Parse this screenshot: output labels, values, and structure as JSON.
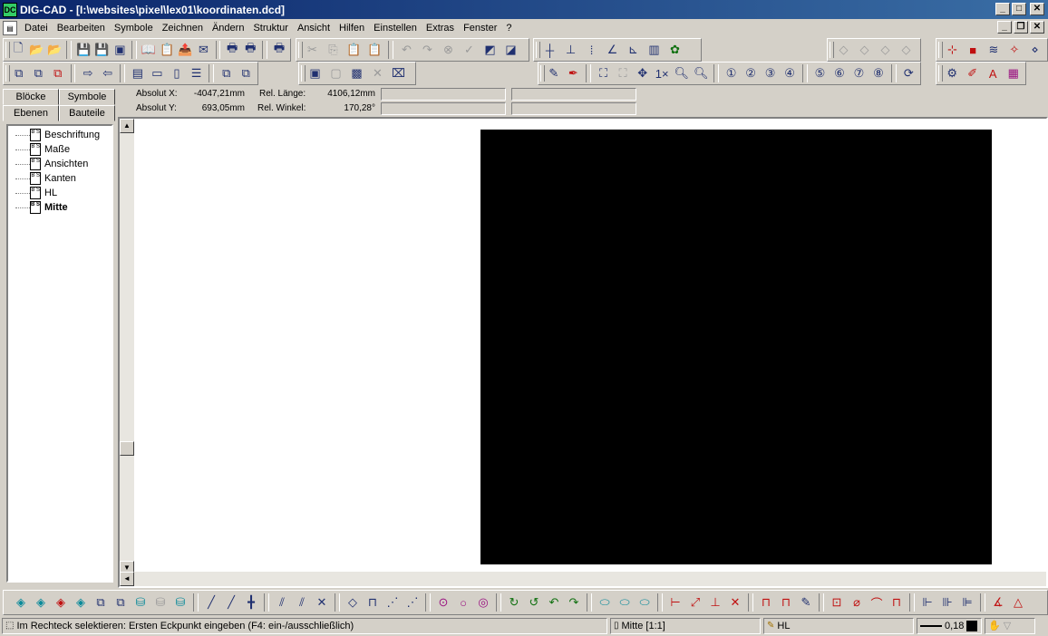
{
  "window": {
    "title": "DIG-CAD - [I:\\websites\\pixel\\lex01\\koordinaten.dcd]",
    "app_icon_label": "DC",
    "buttons": {
      "minimize": "_",
      "maximize": "□",
      "close": "✕"
    }
  },
  "menu": {
    "items": [
      "Datei",
      "Bearbeiten",
      "Symbole",
      "Zeichnen",
      "Ändern",
      "Struktur",
      "Ansicht",
      "Hilfen",
      "Einstellen",
      "Extras",
      "Fenster",
      "?"
    ],
    "mdi_buttons": {
      "minimize": "_",
      "restore": "❐",
      "close": "✕"
    }
  },
  "left_panel": {
    "tabs_top": [
      "Blöcke",
      "Symbole"
    ],
    "tabs_bottom": [
      "Ebenen",
      "Bauteile"
    ],
    "active_tab": "Ebenen",
    "layers": [
      {
        "name": "Beschriftung",
        "bold": false
      },
      {
        "name": "Maße",
        "bold": false
      },
      {
        "name": "Ansichten",
        "bold": false
      },
      {
        "name": "Kanten",
        "bold": false
      },
      {
        "name": "HL",
        "bold": false
      },
      {
        "name": "Mitte",
        "bold": true
      }
    ],
    "layer_icon_letters": "B S"
  },
  "coordinates": {
    "absolut_x_label": "Absolut X:",
    "absolut_x_value": "-4047,21mm",
    "absolut_y_label": "Absolut Y:",
    "absolut_y_value": "693,05mm",
    "rel_laenge_label": "Rel. Länge:",
    "rel_laenge_value": "4106,12mm",
    "rel_winkel_label": "Rel. Winkel:",
    "rel_winkel_value": "170,28°"
  },
  "status": {
    "hint": "Im Rechteck selektieren: Ersten Eckpunkt eingeben (F4: ein-/ausschließlich)",
    "layer": "Mitte [1:1]",
    "pen": "HL",
    "line_width": "0,18"
  },
  "colors": {
    "titlebar_start": "#0a246a",
    "titlebar_end": "#3a6ea5",
    "face": "#d4d0c8",
    "drawing_fill": "#000000"
  }
}
